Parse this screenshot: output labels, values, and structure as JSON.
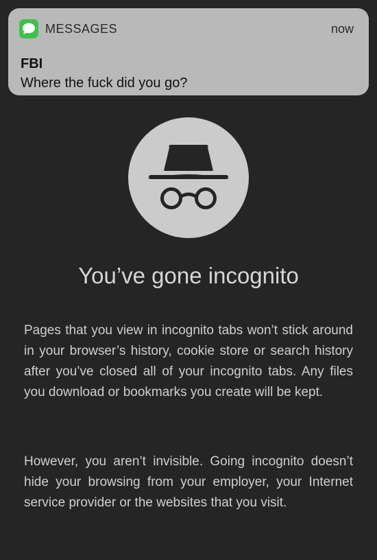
{
  "notification": {
    "app_name": "MESSAGES",
    "time": "now",
    "sender": "FBI",
    "message": "Where the fuck did you go?",
    "app_icon": "messages-bubble-icon",
    "app_icon_color": "#3cc24a"
  },
  "incognito": {
    "icon": "incognito-hat-glasses-icon",
    "headline": "You’ve gone incognito",
    "paragraph1": "Pages that you view in incognito tabs won’t stick around in your browser’s history, cookie store or search history after you’ve closed all of your incognito tabs. Any files you download or bookmarks you create will be kept.",
    "paragraph2": "However, you aren’t invisible. Going incognito doesn’t hide your browsing from your employer, your Internet service provider or the websites that you visit."
  },
  "colors": {
    "background": "#252525",
    "banner": "#b9b9b9",
    "icon_circle": "#cbcbcb",
    "icon_glyph": "#252525",
    "text": "#cfcfcf"
  }
}
